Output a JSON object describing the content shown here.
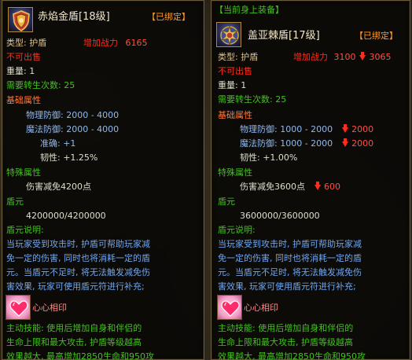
{
  "left": {
    "title": "赤焰金盾[18级]",
    "bound": "【已绑定】",
    "type_label": "类型: 护盾",
    "power_label": "增加战力",
    "power_value": "6165",
    "not_for_sale": "不可出售",
    "weight": "重量: 1",
    "rebirth": "需要转生次数: 25",
    "basic_header": "基础属性",
    "phys_def": "物理防御: 2000 - 4000",
    "magic_def": "魔法防御: 2000 - 4000",
    "accuracy": "准确: +1",
    "toughness": "韧性: +1.25%",
    "special_header": "特殊属性",
    "damage_reduce": "伤害减免4200点",
    "shield_header": "盾元",
    "shield_value": "4200000/4200000",
    "desc_header": "盾元说明:",
    "desc_lines": [
      "当玩家受到攻击时, 护盾可帮助玩家减",
      "免一定的伤害, 同时也将消耗一定的盾",
      "元。当盾元不足时, 将无法触发减免伤",
      "害效果, 玩家可使用盾元符进行补充;"
    ],
    "heart_title": "心心相印",
    "skill_lines": [
      "主动技能: 使用后增加自身和伴侣的",
      "生命上限和最大攻击, 护盾等级越高",
      "效果越大, 最高增加2850生命和950攻"
    ]
  },
  "right": {
    "equipped": "【当前身上装备】",
    "title": "盖亚棘盾[17级]",
    "bound": "【已绑定】",
    "type_label": "类型: 护盾",
    "power_label": "增加战力",
    "power_value": "3100",
    "power_diff": "3065",
    "not_for_sale": "不可出售",
    "weight": "重量: 1",
    "rebirth": "需要转生次数: 25",
    "basic_header": "基础属性",
    "phys_def": "物理防御: 1000 - 2000",
    "phys_diff": "2000",
    "magic_def": "魔法防御: 1000 - 2000",
    "magic_diff": "2000",
    "toughness": "韧性: +1.00%",
    "special_header": "特殊属性",
    "damage_reduce": "伤害减免3600点",
    "damage_diff": "600",
    "shield_header": "盾元",
    "shield_value": "3600000/3600000",
    "desc_header": "盾元说明:",
    "desc_lines": [
      "当玩家受到攻击时, 护盾可帮助玩家减",
      "免一定的伤害, 同时也将消耗一定的盾",
      "元。当盾元不足时, 将无法触发减免伤",
      "害效果, 玩家可使用盾元符进行补充;"
    ],
    "heart_title": "心心相印",
    "skill_lines": [
      "主动技能: 使用后增加自身和伴侣的",
      "生命上限和最大攻击, 护盾等级越高",
      "效果越大, 最高增加2850生命和950攻"
    ]
  },
  "icons": {
    "left_item": "red-gold-shield-icon",
    "right_item": "gaia-thorn-shield-icon",
    "heart": "heart-icon",
    "down_arrow": "down-arrow-icon"
  },
  "colors": {
    "bound": "#ff9a2e",
    "power": "#ff2b1b",
    "green": "#42c21e",
    "section": "#ff7a3a",
    "stat": "#8fb9ef",
    "description": "#6fa6ef"
  }
}
